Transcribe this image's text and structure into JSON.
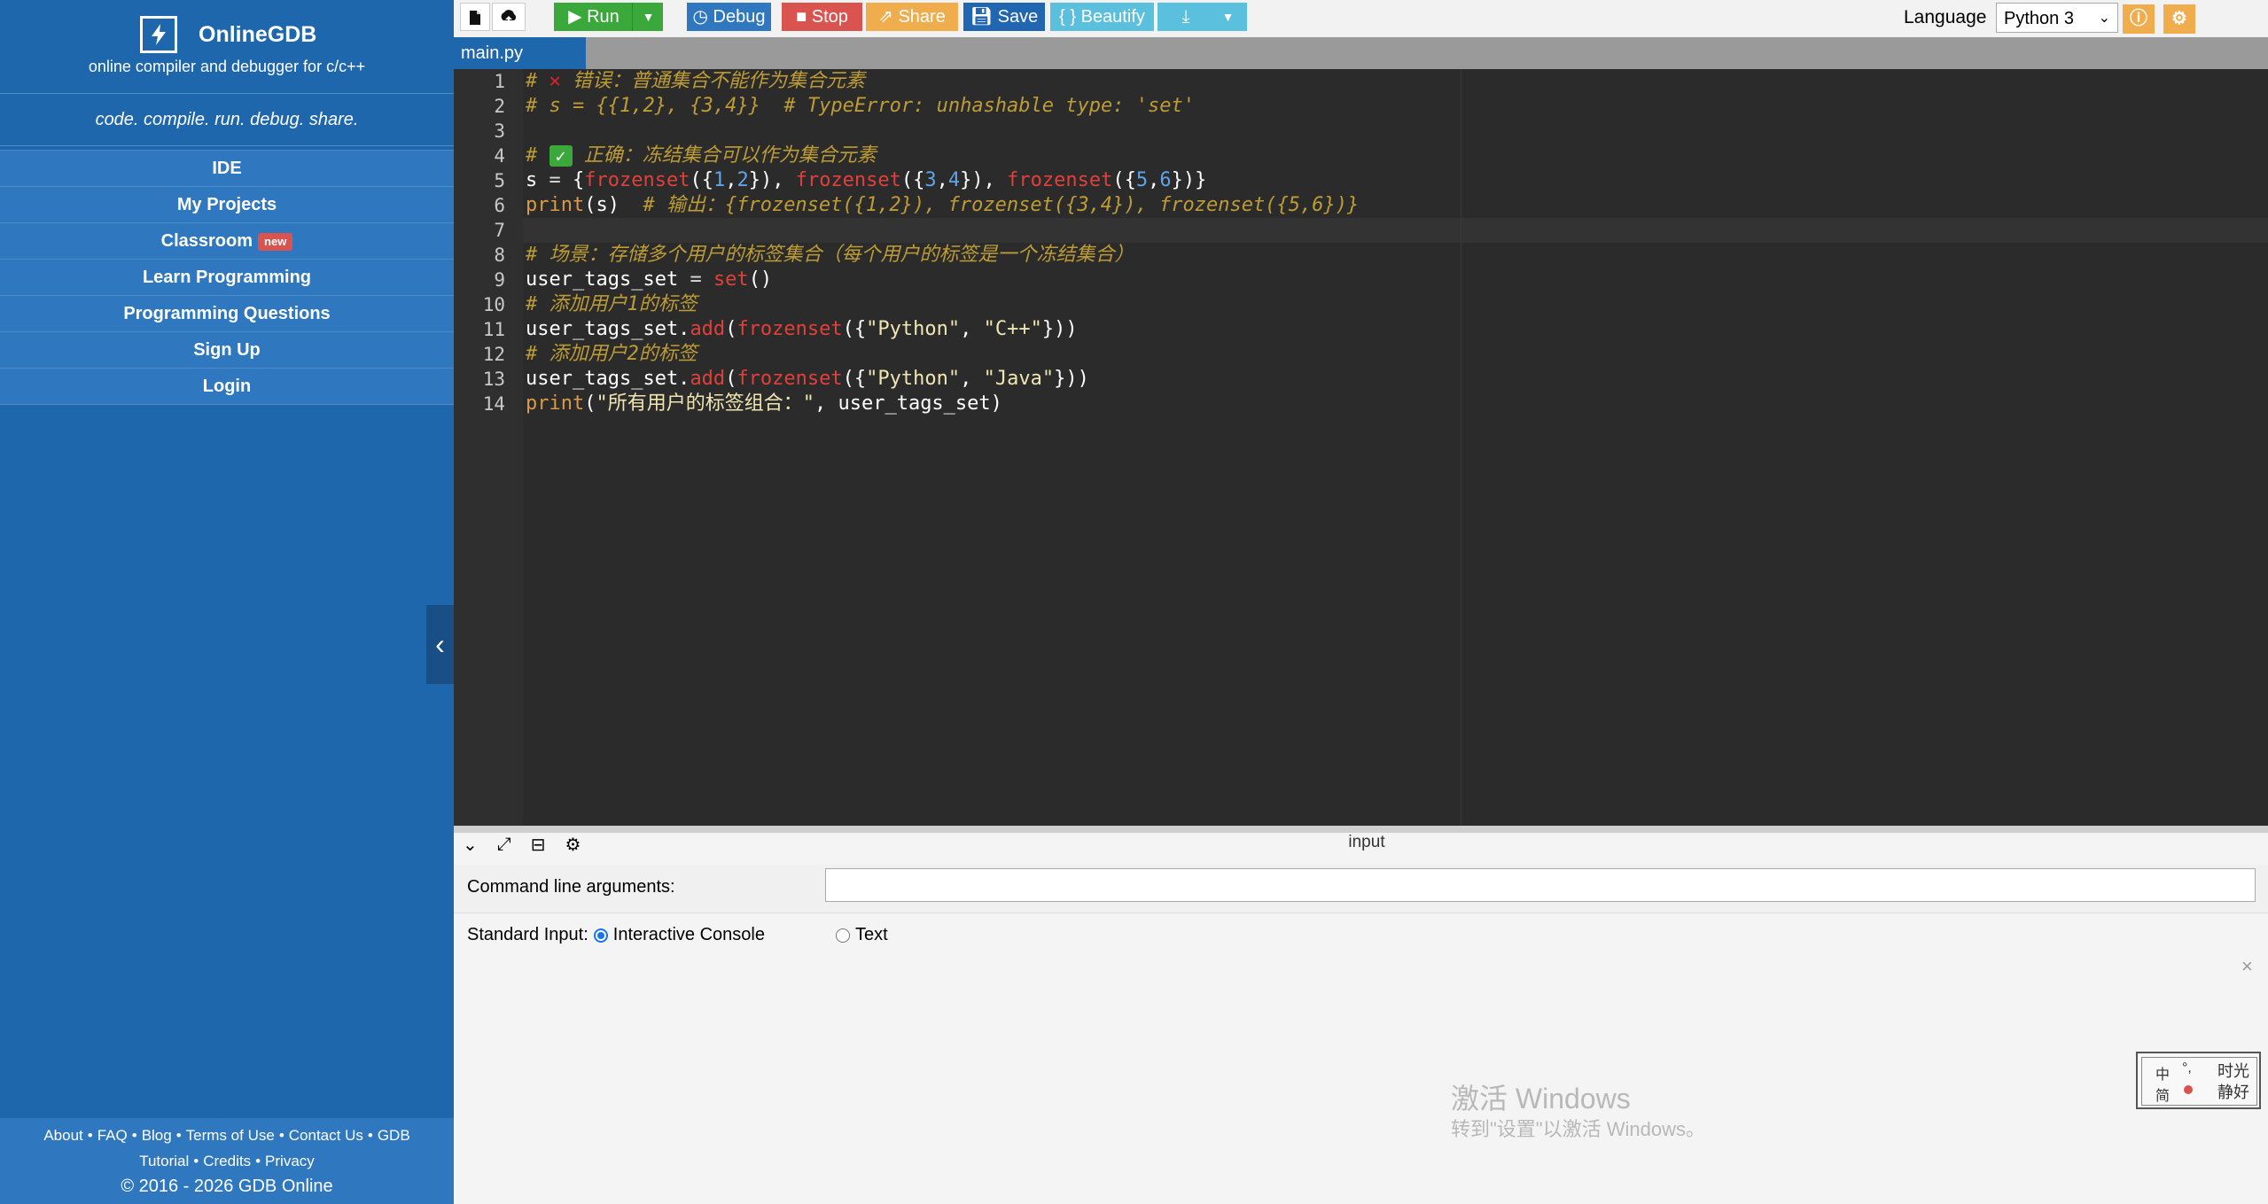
{
  "sidebar": {
    "brand_name": "OnlineGDB",
    "tagline": "online compiler and debugger for c/c++",
    "motto": "code. compile. run. debug. share.",
    "nav": [
      {
        "label": "IDE"
      },
      {
        "label": "My Projects"
      },
      {
        "label": "Classroom",
        "badge": "new"
      },
      {
        "label": "Learn Programming"
      },
      {
        "label": "Programming Questions"
      },
      {
        "label": "Sign Up"
      },
      {
        "label": "Login"
      }
    ],
    "footer": {
      "links_line1": [
        "About",
        "FAQ",
        "Blog",
        "Terms of Use",
        "Contact Us",
        "GDB"
      ],
      "links_line2": [
        "Tutorial",
        "Credits",
        "Privacy"
      ],
      "copyright": "© 2016 - 2026 GDB Online"
    },
    "collapse_icon": "chevron-left-icon"
  },
  "toolbar": {
    "run": "Run",
    "debug": "Debug",
    "stop": "Stop",
    "share": "Share",
    "save": "Save",
    "beautify": "{ } Beautify",
    "language_label": "Language",
    "language_value": "Python 3",
    "colors": {
      "run": "#3aa83a",
      "debug": "#2f78bf",
      "stop": "#d9534f",
      "share": "#f0ad4e",
      "save": "#2166b0",
      "beautify": "#5bc0de",
      "download": "#5bc0de"
    }
  },
  "tabs": [
    {
      "label": "main.py"
    }
  ],
  "editor": {
    "line_numbers": [
      "1",
      "2",
      "3",
      "4",
      "5",
      "6",
      "7",
      "8",
      "9",
      "10",
      "11",
      "12",
      "13",
      "14"
    ],
    "lines": {
      "l1_comment": "# ",
      "l1_mark": "✕",
      "l1_text": " 错误：普通集合不能作为集合元素",
      "l2": "# s = {{1,2}, {3,4}}  # TypeError: unhashable type: 'set'",
      "l4_comment": "# ",
      "l4_mark": "✓",
      "l4_text": " 正确：冻结集合可以作为集合元素",
      "l8": "# 场景：存储多个用户的标签集合（每个用户的标签是一个冻结集合）",
      "l10": "# 添加用户1的标签",
      "l12": "# 添加用户2的标签",
      "l6_comment": "  # 输出：{frozenset({1,2}), frozenset({3,4}), frozenset({5,6})}",
      "l14_str": "\"所有用户的标签组合：\""
    }
  },
  "panel": {
    "title": "input",
    "cmd_label": "Command line arguments:",
    "cmd_value": "",
    "stdin_label": "Standard Input:",
    "option_console": "Interactive Console",
    "option_text": "Text",
    "selected": "Interactive Console"
  },
  "overlay": {
    "activate_title": "激活 Windows",
    "activate_sub": "转到\"设置\"以激活 Windows。",
    "ime_chars": [
      "中",
      "°,",
      "简",
      "时光",
      "静好"
    ]
  }
}
